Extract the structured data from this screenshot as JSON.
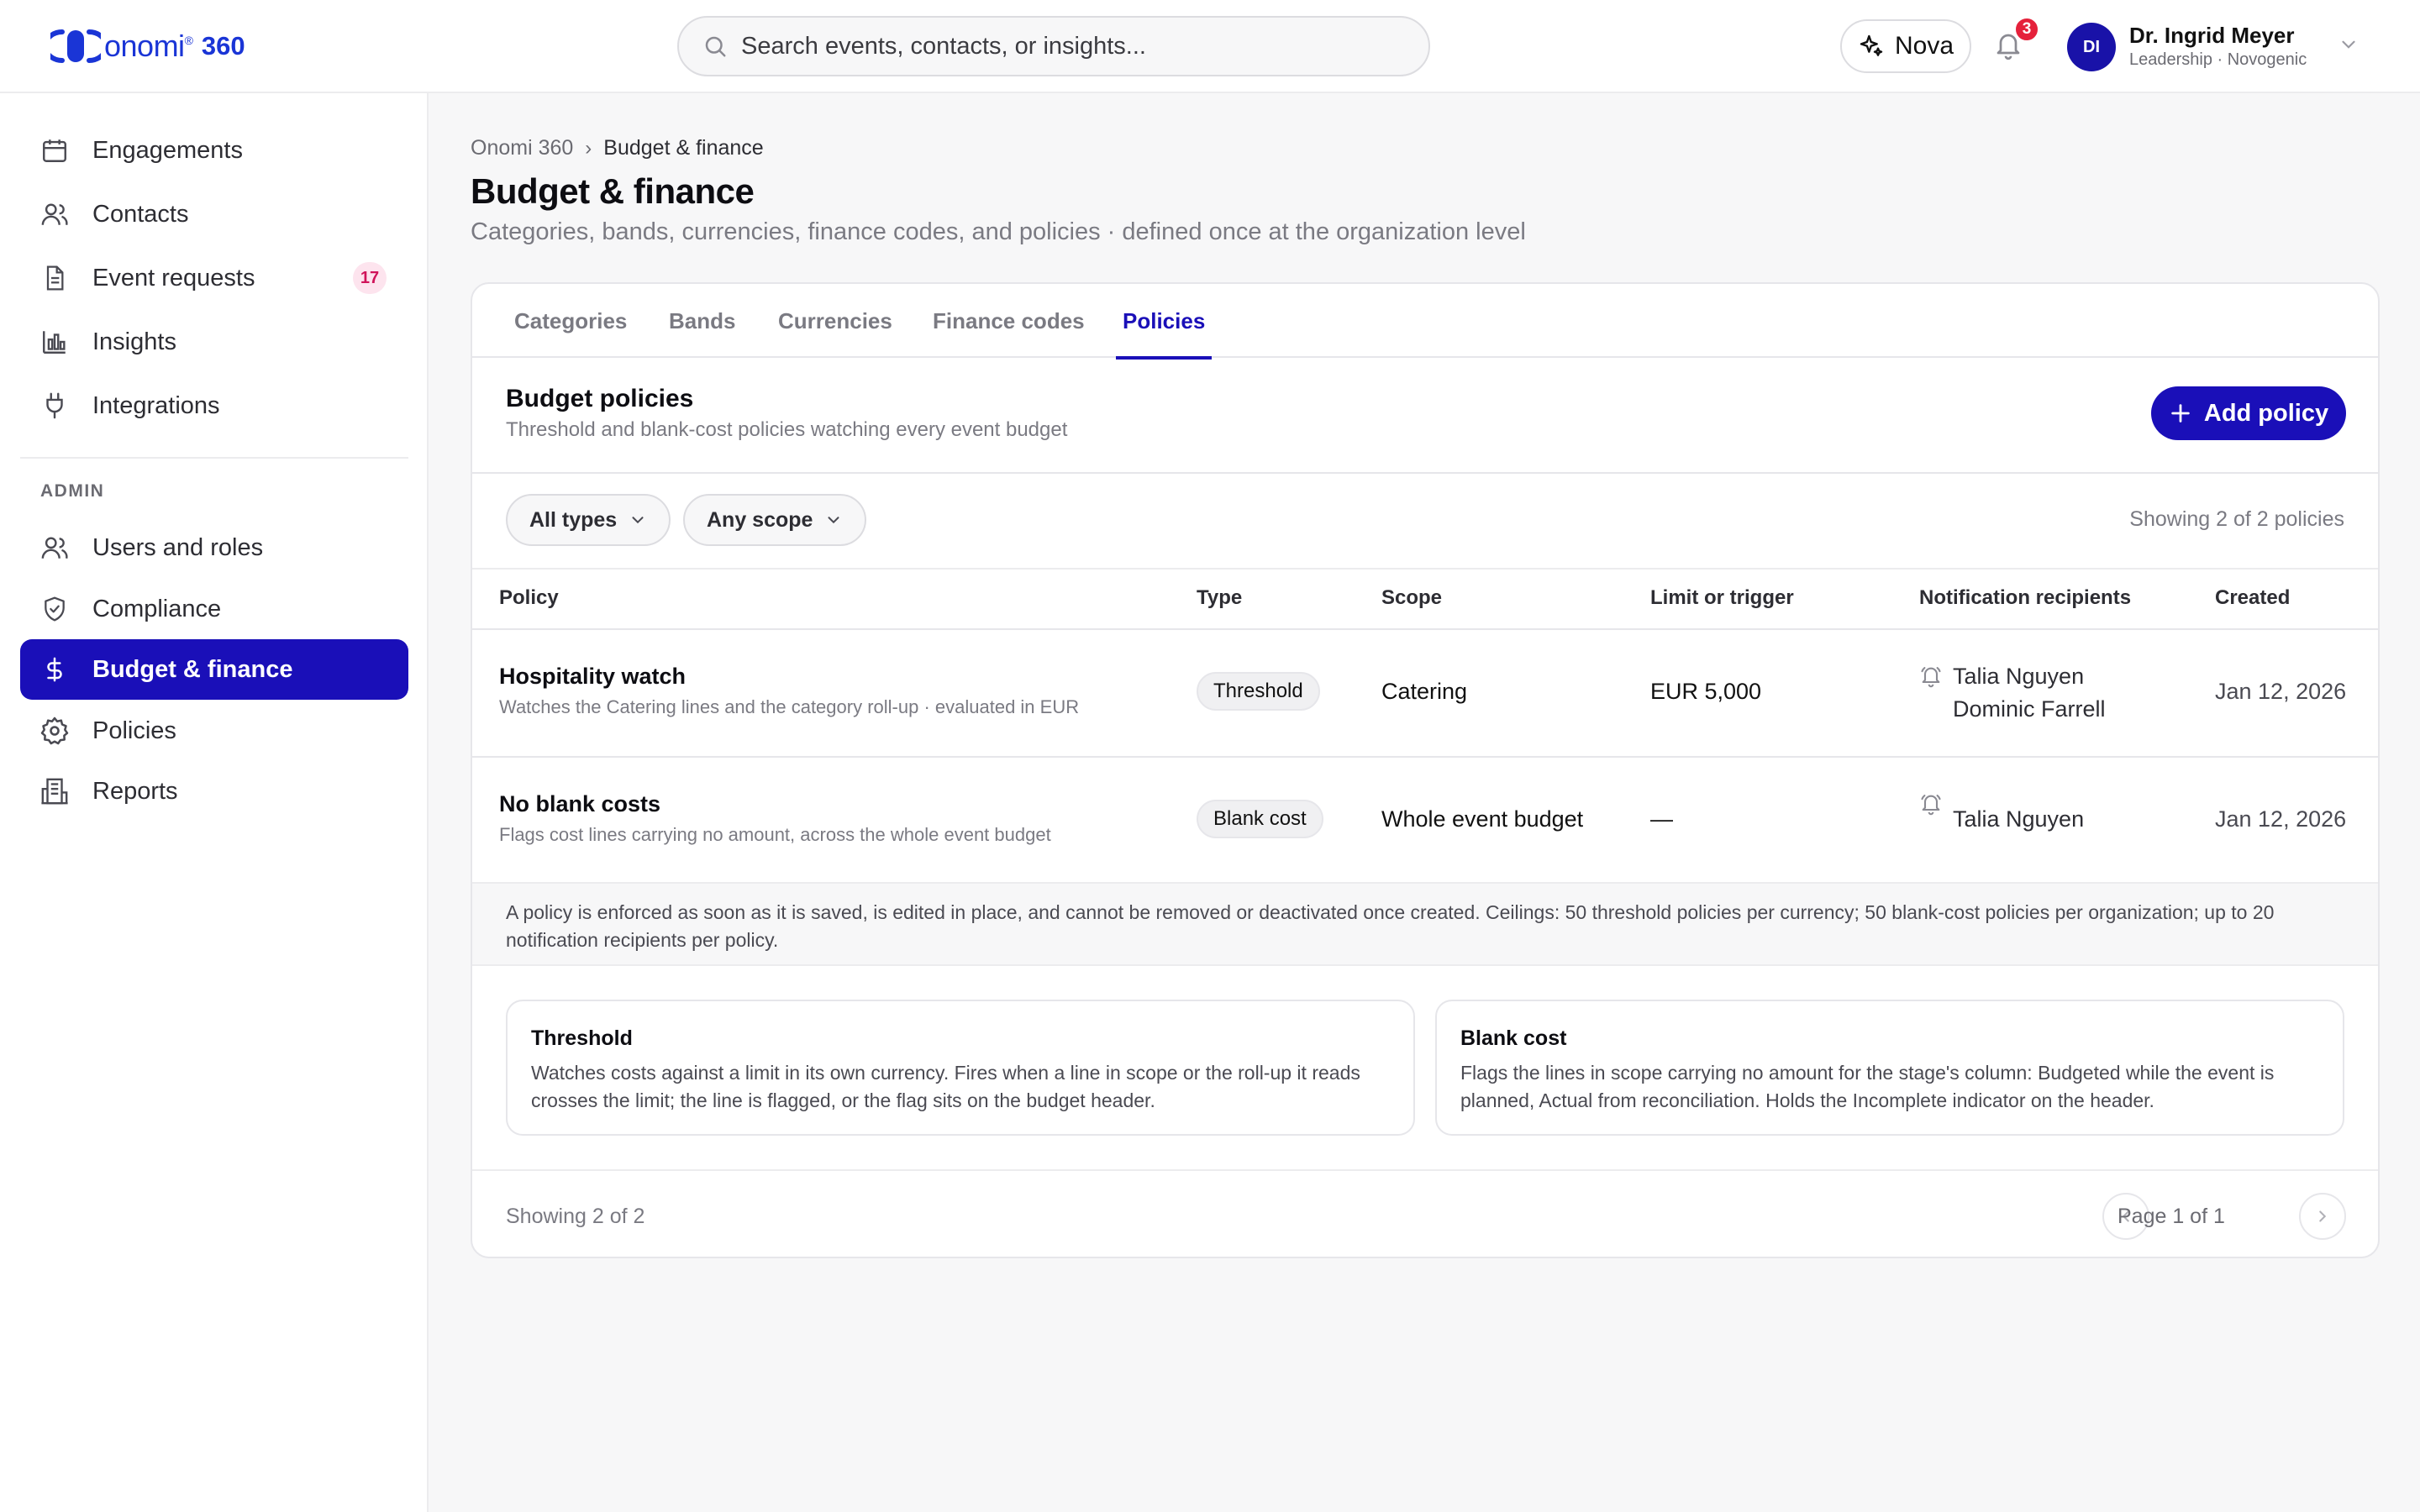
{
  "brand": {
    "name": "onomi",
    "reg": "®",
    "product": "360"
  },
  "search": {
    "placeholder": "Search events, contacts, or insights..."
  },
  "header": {
    "assistant_label": "Nova",
    "notification_count": "3",
    "user": {
      "initials": "DI",
      "name": "Dr. Ingrid Meyer",
      "subtitle": "Leadership · Novogenic"
    }
  },
  "sidebar": {
    "items": [
      {
        "label": "Engagements",
        "icon": "calendar-icon"
      },
      {
        "label": "Contacts",
        "icon": "users-icon"
      },
      {
        "label": "Event requests",
        "icon": "document-icon",
        "badge": "17"
      },
      {
        "label": "Insights",
        "icon": "bar-chart-icon"
      },
      {
        "label": "Integrations",
        "icon": "plug-icon"
      }
    ],
    "admin_section": "ADMIN",
    "admin_items": [
      {
        "label": "Users and roles",
        "icon": "users-icon"
      },
      {
        "label": "Compliance",
        "icon": "shield-check-icon"
      },
      {
        "label": "Budget & finance",
        "icon": "dollar-icon",
        "active": true
      },
      {
        "label": "Policies",
        "icon": "gear-icon"
      },
      {
        "label": "Reports",
        "icon": "building-icon"
      }
    ]
  },
  "breadcrumb": {
    "root": "Onomi 360",
    "separator": "›",
    "current": "Budget & finance"
  },
  "page": {
    "title": "Budget & finance",
    "subtitle": "Categories, bands, currencies, finance codes, and policies · defined once at the organization level"
  },
  "tabs": [
    {
      "label": "Categories"
    },
    {
      "label": "Bands"
    },
    {
      "label": "Currencies"
    },
    {
      "label": "Finance codes"
    },
    {
      "label": "Policies",
      "active": true
    }
  ],
  "section": {
    "title": "Budget policies",
    "subtitle": "Threshold and blank-cost policies watching every event budget",
    "add_label": "Add policy"
  },
  "filters": {
    "type": "All types",
    "scope": "Any scope",
    "showing": "Showing 2 of 2 policies"
  },
  "table": {
    "columns": [
      "Policy",
      "Type",
      "Scope",
      "Limit or trigger",
      "Notification recipients",
      "Created"
    ],
    "rows": [
      {
        "name": "Hospitality watch",
        "description": "Watches the Catering lines and the category roll-up · evaluated in EUR",
        "type": "Threshold",
        "scope": "Catering",
        "limit": "EUR 5,000",
        "recipients": [
          "Talia Nguyen",
          "Dominic Farrell"
        ],
        "created": "Jan 12, 2026"
      },
      {
        "name": "No blank costs",
        "description": "Flags cost lines carrying no amount, across the whole event budget",
        "type": "Blank cost",
        "scope": "Whole event budget",
        "limit": "—",
        "recipients": [
          "Talia Nguyen"
        ],
        "created": "Jan 12, 2026"
      }
    ]
  },
  "note": "A policy is enforced as soon as it is saved, is edited in place, and cannot be removed or deactivated once created. Ceilings: 50 threshold policies per currency; 50 blank-cost policies per organization; up to 20 notification recipients per policy.",
  "explainers": [
    {
      "title": "Threshold",
      "text": "Watches costs against a limit in its own currency. Fires when a line in scope or the roll-up it reads crosses the limit; the line is flagged, or the flag sits on the budget header."
    },
    {
      "title": "Blank cost",
      "text": "Flags the lines in scope carrying no amount for the stage's column: Budgeted while the event is planned, Actual from reconciliation. Holds the Incomplete indicator on the header."
    }
  ],
  "footer": {
    "showing": "Showing 2 of 2",
    "page_label": "Page 1 of 1"
  },
  "colors": {
    "accent": "#1a0fb8",
    "brand": "#1a35d6",
    "badge_red": "#e5213b",
    "badge_pink": "#d0145a"
  }
}
